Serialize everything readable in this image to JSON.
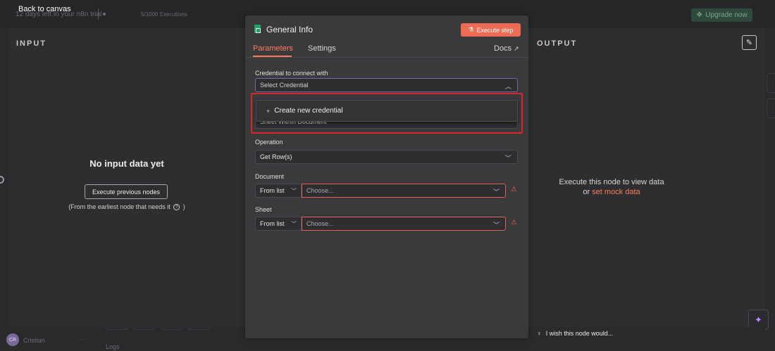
{
  "topbar": {
    "back_label": "Back to canvas",
    "trial_text": "12 days left in your n8n trial",
    "executions": "5/1000 Executions",
    "upgrade_label": "Upgrade now"
  },
  "sidebar": {
    "user_initials": "CR",
    "user_name": "Cristian",
    "more": "···"
  },
  "footer": {
    "logs_label": "Logs"
  },
  "input_panel": {
    "heading": "INPUT",
    "empty_title": "No input data yet",
    "execute_previous_label": "Execute previous nodes",
    "hint_before": "(From the earliest node that needs it",
    "hint_after": ")"
  },
  "output_panel": {
    "heading": "OUTPUT",
    "message_line1": "Execute this node to view data",
    "message_or": "or",
    "mock_link": "set mock data",
    "wish_text": "I wish this node would..."
  },
  "node": {
    "title": "General Info",
    "execute_step_label": "Execute step",
    "tabs": {
      "parameters": "Parameters",
      "settings": "Settings",
      "docs": "Docs"
    },
    "credential": {
      "label": "Credential to connect with",
      "placeholder": "Select Credential",
      "dropdown_option": "Create new credential"
    },
    "resource": {
      "value": "Sheet Within Document"
    },
    "operation": {
      "label": "Operation",
      "value": "Get Row(s)"
    },
    "document": {
      "label": "Document",
      "mode": "From list",
      "placeholder": "Choose..."
    },
    "sheet": {
      "label": "Sheet",
      "mode": "From list",
      "placeholder": "Choose..."
    }
  },
  "colors": {
    "accent": "#ff7a5c",
    "execute_button": "#ee6c54",
    "error_border": "#e0605a",
    "highlight": "#d8262a",
    "sheets_icon": "#21a366"
  }
}
